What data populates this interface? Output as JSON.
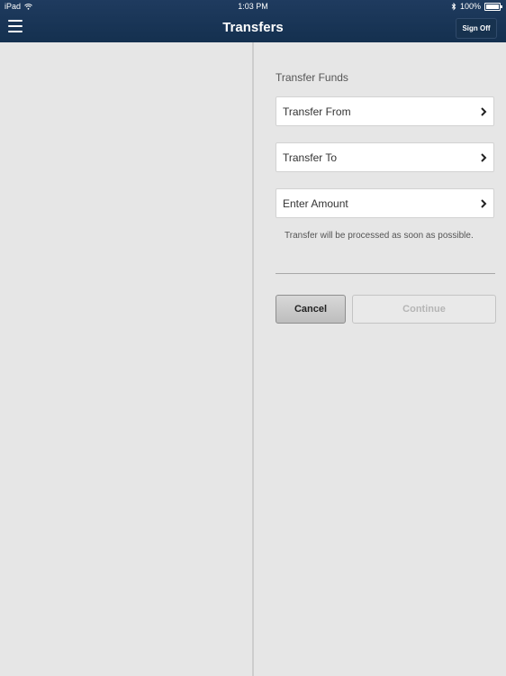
{
  "status_bar": {
    "device": "iPad",
    "time": "1:03 PM",
    "battery": "100%"
  },
  "header": {
    "title": "Transfers",
    "sign_off_label": "Sign Off"
  },
  "form": {
    "section_title": "Transfer Funds",
    "transfer_from_label": "Transfer From",
    "transfer_to_label": "Transfer To",
    "amount_label": "Enter Amount",
    "note": "Transfer will be processed as soon as possible.",
    "cancel_label": "Cancel",
    "continue_label": "Continue"
  },
  "icons": {
    "menu": "hamburger-menu-icon",
    "wifi": "wifi-icon",
    "bluetooth": "bluetooth-icon",
    "battery": "battery-icon",
    "chevron": "chevron-right-icon"
  },
  "colors": {
    "header_bg": "#1a3657",
    "pane_bg": "#e6e6e6",
    "divider": "#cdcdcd"
  }
}
